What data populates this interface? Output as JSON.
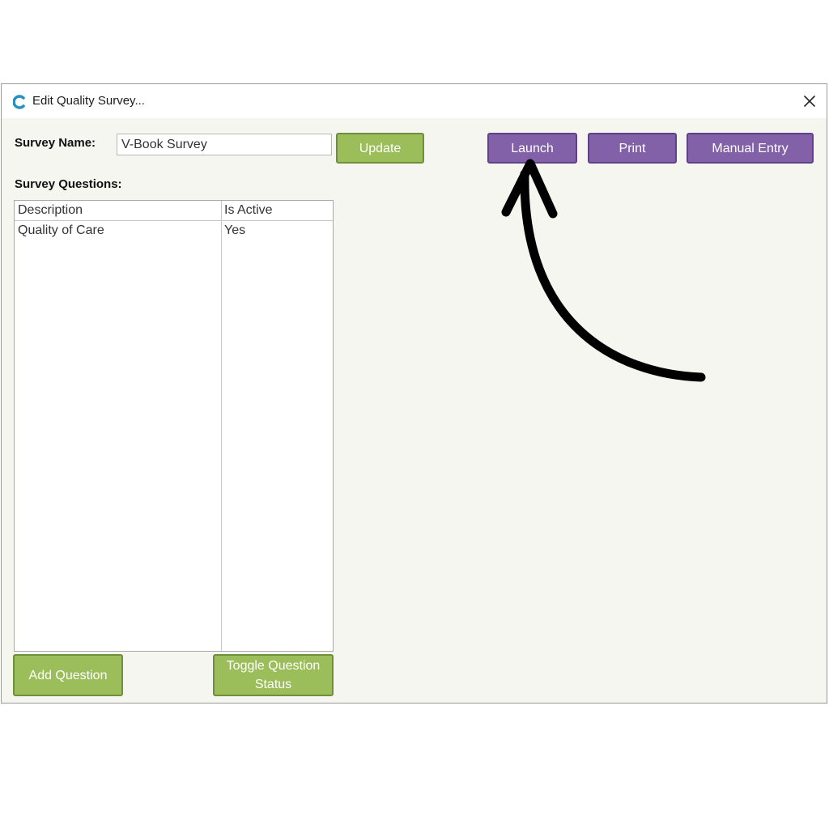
{
  "window": {
    "title": "Edit Quality Survey..."
  },
  "survey": {
    "name_label": "Survey Name:",
    "name_value": "V-Book Survey",
    "update_label": "Update",
    "questions_label": "Survey Questions:"
  },
  "actions": {
    "launch_label": "Launch",
    "print_label": "Print",
    "manual_entry_label": "Manual Entry"
  },
  "table": {
    "columns": [
      "Description",
      "Is Active"
    ],
    "rows": [
      [
        "Quality of Care",
        "Yes"
      ]
    ]
  },
  "footer": {
    "add_question_label": "Add Question",
    "toggle_status_line1": "Toggle Question",
    "toggle_status_line2": "Status"
  },
  "colors": {
    "green_button": "#9bbd5a",
    "purple_button": "#8261a8",
    "window_bg": "#f5f6ef",
    "app_icon": "#2a8fc1"
  },
  "icons": {
    "app": "app-logo-icon",
    "close": "close-icon",
    "annotation": "curved-arrow-icon"
  }
}
